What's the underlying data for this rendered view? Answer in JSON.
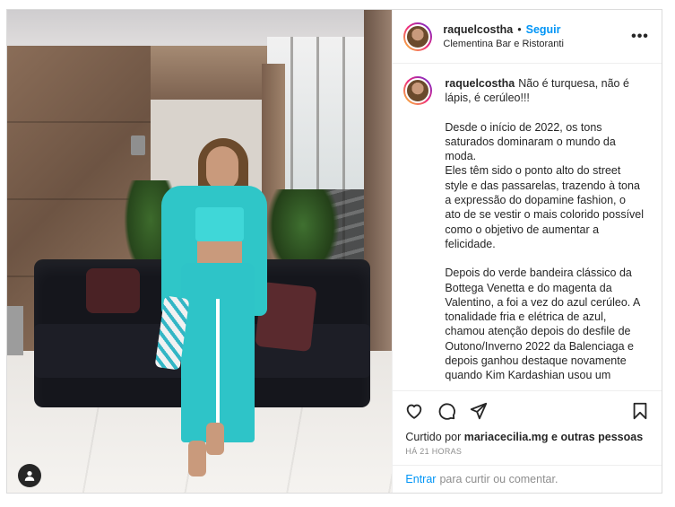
{
  "header": {
    "username": "raquelcostha",
    "separator": "•",
    "follow_label": "Seguir",
    "location": "Clementina Bar e Ristoranti",
    "more_icon": "more-dots-icon",
    "more_glyph": "•••"
  },
  "caption": {
    "username": "raquelcostha",
    "lead": "Não é turquesa, não é lápis, é cerúleo!!!",
    "paragraphs": [
      "Desde o início de 2022, os tons saturados dominaram o mundo da moda.",
      "Eles têm sido o ponto alto do street style e das passarelas, trazendo à tona a expressão do dopamine fashion, o ato de se vestir o mais colorido possível como o objetivo de aumentar a felicidade.",
      "Depois do verde bandeira clássico da Bottega Venetta e do magenta da Valentino, a foi a vez do azul cerúleo. A tonalidade fria e elétrica de azul, chamou atenção depois do desfile de Outono/Inverno 2022 da Balenciaga e depois ganhou destaque novamente quando Kim Kardashian usou um"
    ]
  },
  "actions": {
    "like_icon": "heart-icon",
    "comment_icon": "comment-icon",
    "share_icon": "share-icon",
    "save_icon": "bookmark-icon"
  },
  "likes": {
    "prefix": "Curtido por",
    "user": "mariacecilia.mg",
    "suffix": "e outras pessoas"
  },
  "timestamp": "HÁ 21 HORAS",
  "comment_box": {
    "login_label": "Entrar",
    "prompt": "para curtir ou comentar."
  },
  "colors": {
    "accent": "#0095f6",
    "muted": "#8e8e8e",
    "text": "#262626"
  }
}
